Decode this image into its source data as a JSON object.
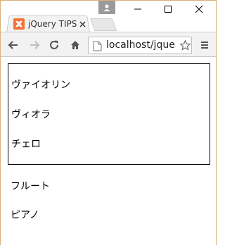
{
  "browser": {
    "tab": {
      "title": "jQuery TIPS",
      "favicon": "xampp-icon"
    },
    "url": "localhost/jque",
    "colors": {
      "favicon": "#f2743a",
      "frame_border": "#d8b077",
      "toolbar": "#f2f2f2"
    }
  },
  "page": {
    "boxed_items": [
      "ヴァイオリン",
      "ヴィオラ",
      "チェロ"
    ],
    "other_items": [
      "フルート",
      "ピアノ"
    ]
  }
}
